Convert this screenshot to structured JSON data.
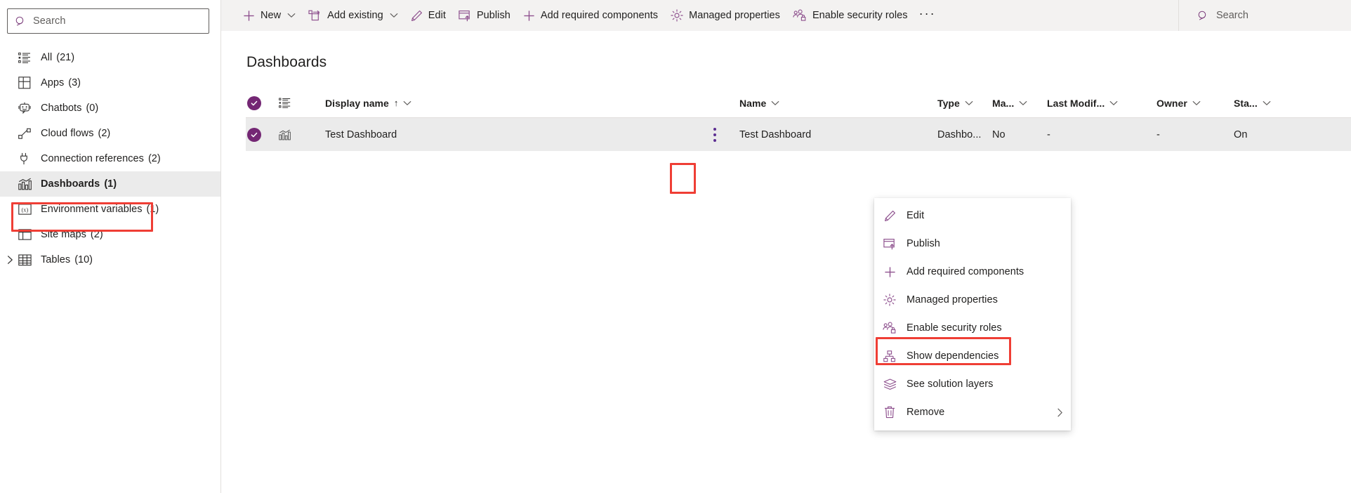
{
  "sidebar": {
    "search": {
      "placeholder": "Search",
      "value": "",
      "icon": "search-icon"
    },
    "items": [
      {
        "label": "All",
        "count": "(21)",
        "icon": "list-icon",
        "selected": false,
        "expandable": false
      },
      {
        "label": "Apps",
        "count": "(3)",
        "icon": "apps-grid-icon",
        "selected": false,
        "expandable": false
      },
      {
        "label": "Chatbots",
        "count": "(0)",
        "icon": "chatbot-icon",
        "selected": false,
        "expandable": false
      },
      {
        "label": "Cloud flows",
        "count": "(2)",
        "icon": "cloud-flow-icon",
        "selected": false,
        "expandable": false
      },
      {
        "label": "Connection references",
        "count": "(2)",
        "icon": "plug-icon",
        "selected": false,
        "expandable": false
      },
      {
        "label": "Dashboards",
        "count": "(1)",
        "icon": "dashboard-chart-icon",
        "selected": true,
        "expandable": false
      },
      {
        "label": "Environment variables",
        "count": "(1)",
        "icon": "variable-icon",
        "selected": false,
        "expandable": false
      },
      {
        "label": "Site maps",
        "count": "(2)",
        "icon": "sitemap-layout-icon",
        "selected": false,
        "expandable": false
      },
      {
        "label": "Tables",
        "count": "(10)",
        "icon": "table-grid-icon",
        "selected": false,
        "expandable": true
      }
    ]
  },
  "commandbar": {
    "buttons": [
      {
        "label": "New",
        "icon": "plus-icon",
        "chevron": true
      },
      {
        "label": "Add existing",
        "icon": "add-existing-icon",
        "chevron": true
      },
      {
        "label": "Edit",
        "icon": "pencil-icon",
        "chevron": false
      },
      {
        "label": "Publish",
        "icon": "publish-upload-icon",
        "chevron": false
      },
      {
        "label": "Add required components",
        "icon": "plus-icon",
        "chevron": false
      },
      {
        "label": "Managed properties",
        "icon": "gear-icon",
        "chevron": false
      },
      {
        "label": "Enable security roles",
        "icon": "security-roles-icon",
        "chevron": false
      }
    ],
    "overflow_label": "···",
    "search": {
      "placeholder": "Search",
      "value": "",
      "icon": "search-icon"
    }
  },
  "page": {
    "title": "Dashboards"
  },
  "grid": {
    "columns": [
      {
        "key": "display_name",
        "label": "Display name",
        "sorted": "↑",
        "chevron": true
      },
      {
        "key": "name",
        "label": "Name",
        "sorted": "",
        "chevron": true
      },
      {
        "key": "type",
        "label": "Type",
        "sorted": "",
        "chevron": true
      },
      {
        "key": "managed",
        "label": "Ma...",
        "sorted": "",
        "chevron": true
      },
      {
        "key": "last_modified",
        "label": "Last Modif...",
        "sorted": "",
        "chevron": true
      },
      {
        "key": "owner",
        "label": "Owner",
        "sorted": "",
        "chevron": true
      },
      {
        "key": "status",
        "label": "Sta...",
        "sorted": "",
        "chevron": true
      }
    ],
    "rows": [
      {
        "selected": true,
        "row_icon": "dashboard-chart-icon",
        "display_name": "Test Dashboard",
        "name": "Test Dashboard",
        "type": "Dashbo...",
        "managed": "No",
        "last_modified": "-",
        "owner": "-",
        "status": "On"
      }
    ]
  },
  "context_menu": {
    "items": [
      {
        "label": "Edit",
        "icon": "pencil-icon",
        "submenu": false,
        "highlighted": false
      },
      {
        "label": "Publish",
        "icon": "publish-upload-icon",
        "submenu": false,
        "highlighted": false
      },
      {
        "label": "Add required components",
        "icon": "plus-icon",
        "submenu": false,
        "highlighted": false
      },
      {
        "label": "Managed properties",
        "icon": "gear-icon",
        "submenu": false,
        "highlighted": false
      },
      {
        "label": "Enable security roles",
        "icon": "security-roles-icon",
        "submenu": false,
        "highlighted": true
      },
      {
        "label": "Show dependencies",
        "icon": "dependencies-icon",
        "submenu": false,
        "highlighted": false
      },
      {
        "label": "See solution layers",
        "icon": "layers-icon",
        "submenu": false,
        "highlighted": false
      },
      {
        "label": "Remove",
        "icon": "trash-icon",
        "submenu": true,
        "highlighted": false
      }
    ]
  },
  "colors": {
    "accent_purple": "#742774",
    "icon_purple": "#8d4f8d",
    "highlight_red": "#ef3e35",
    "row_selected_bg": "#ebebeb",
    "commandbar_bg": "#f3f2f1",
    "text_primary": "#201f1e",
    "text_secondary": "#605e5c"
  }
}
